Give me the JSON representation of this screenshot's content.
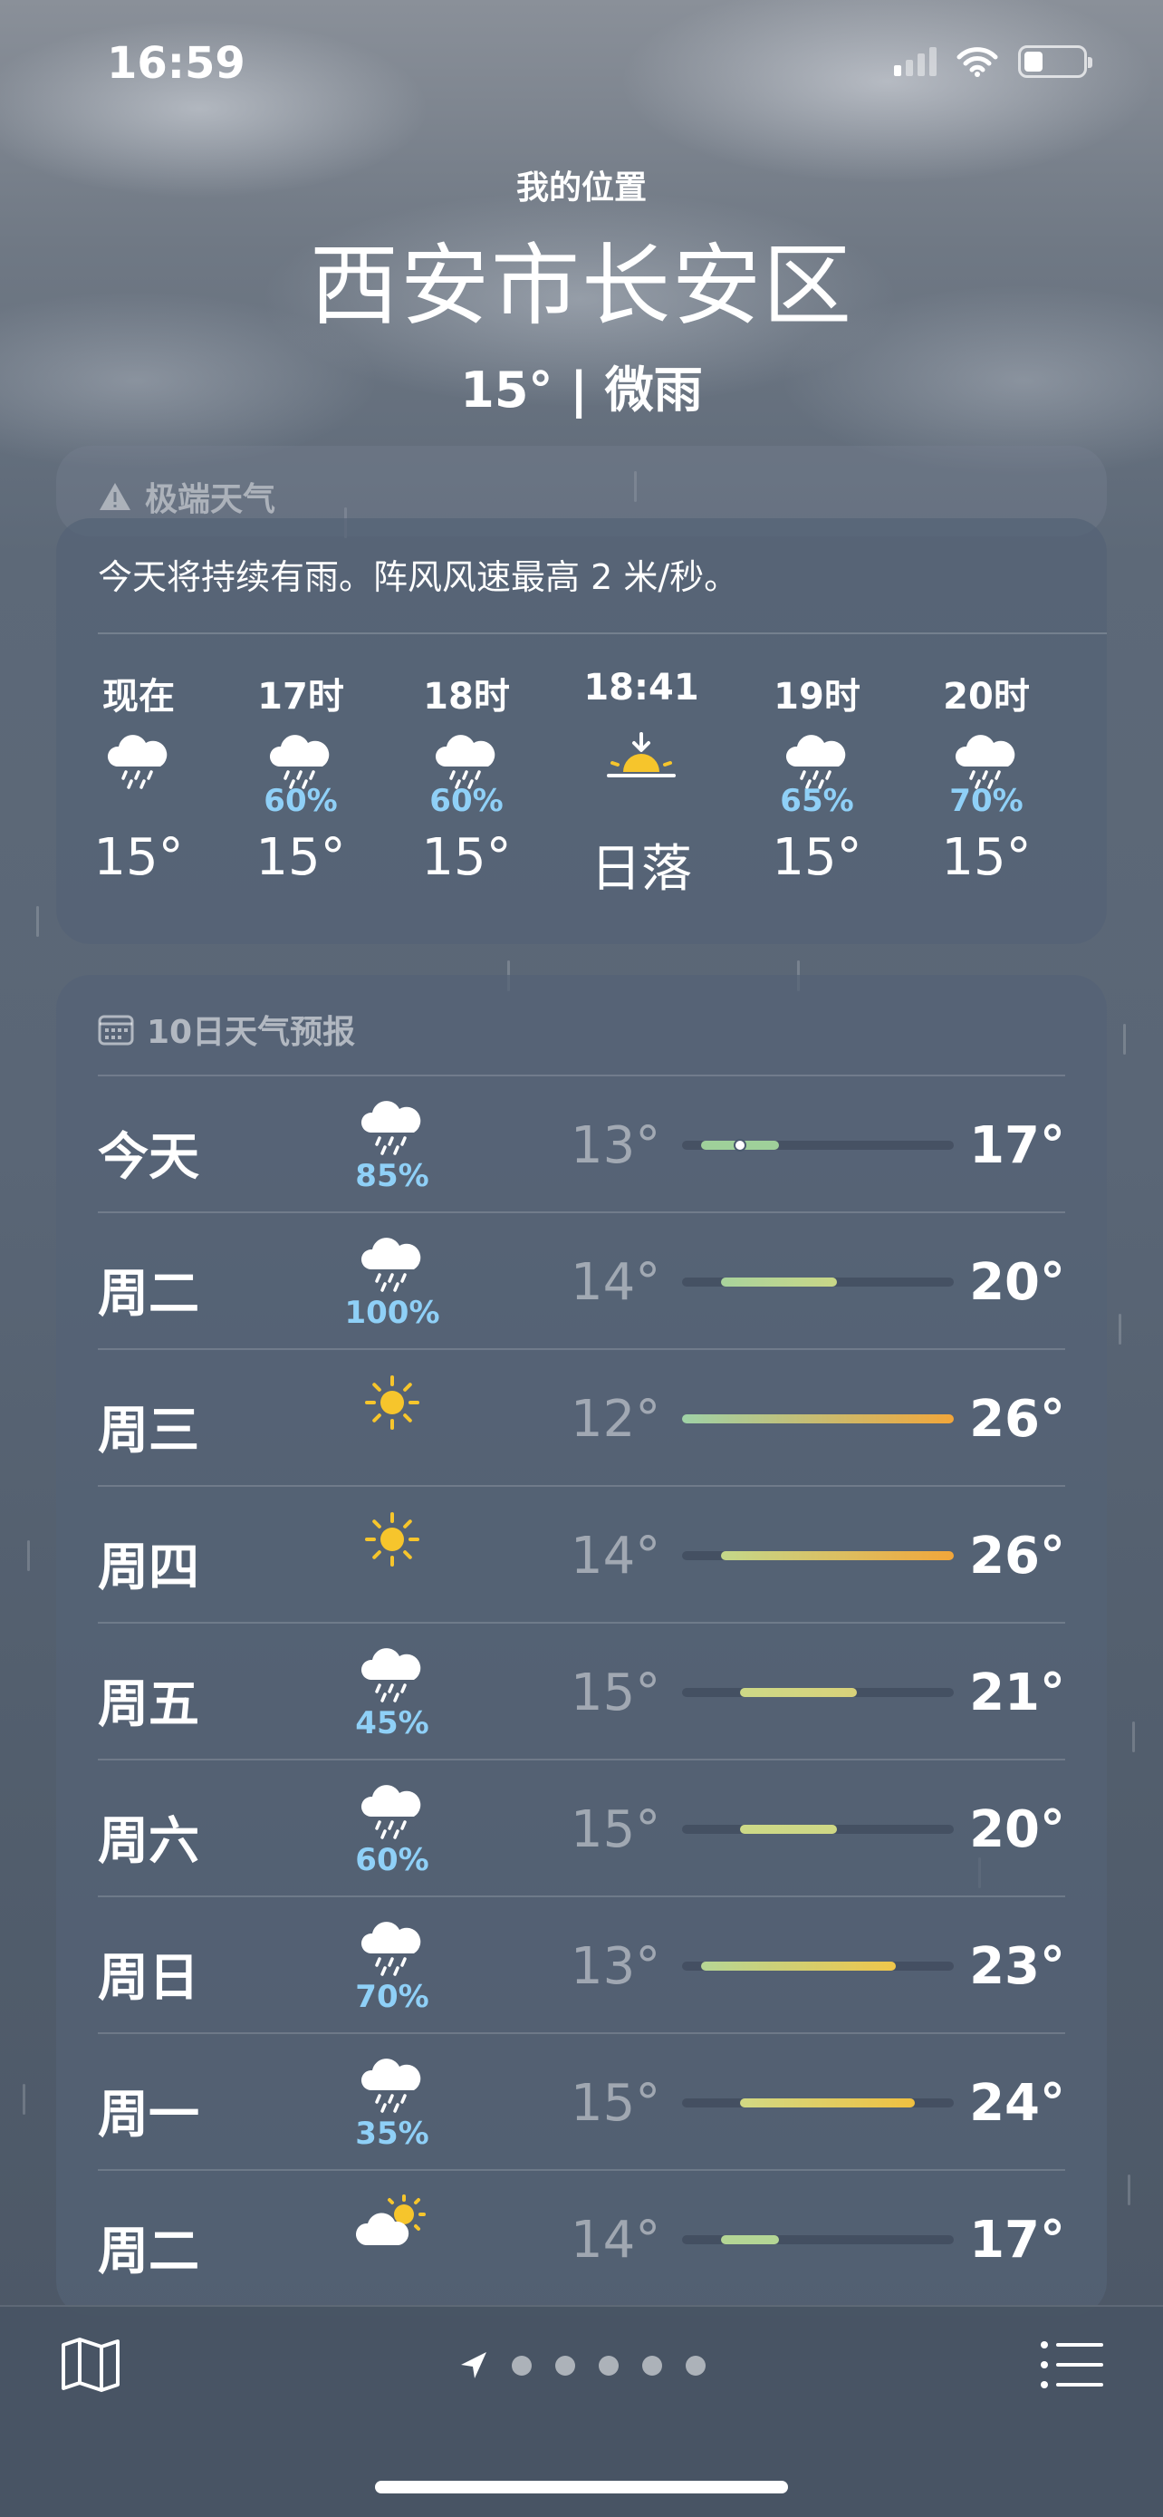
{
  "status_bar": {
    "time": "16:59"
  },
  "header": {
    "location_label": "我的位置",
    "city": "西安市长安区",
    "current": "15° | 微雨"
  },
  "alert": {
    "title": "极端天气"
  },
  "hourly": {
    "summary": "今天将持续有雨。阵风风速最高 2 米/秒。",
    "items": [
      {
        "label": "现在",
        "icon": "rain-cloud-icon",
        "precip": "",
        "temp": "15°"
      },
      {
        "label": "17时",
        "icon": "rain-cloud-icon",
        "precip": "60%",
        "temp": "15°"
      },
      {
        "label": "18时",
        "icon": "rain-cloud-icon",
        "precip": "60%",
        "temp": "15°"
      },
      {
        "label": "18:41",
        "icon": "sunset-icon",
        "precip": "",
        "temp": "日落"
      },
      {
        "label": "19时",
        "icon": "rain-cloud-icon",
        "precip": "65%",
        "temp": "15°"
      },
      {
        "label": "20时",
        "icon": "rain-cloud-icon",
        "precip": "70%",
        "temp": "15°"
      }
    ]
  },
  "daily": {
    "title": "10日天气预报",
    "range_min": 12,
    "range_max": 26,
    "days": [
      {
        "day": "今天",
        "icon": "rain-cloud-icon",
        "precip": "85%",
        "low": "13°",
        "high": "17°",
        "low_val": 13,
        "high_val": 17,
        "current_val": 15,
        "bar_colors": [
          "#9fd09a",
          "#9fd09a"
        ]
      },
      {
        "day": "周二",
        "icon": "rain-cloud-icon",
        "precip": "100%",
        "low": "14°",
        "high": "20°",
        "low_val": 14,
        "high_val": 20,
        "bar_colors": [
          "#a9d39c",
          "#c9d787"
        ]
      },
      {
        "day": "周三",
        "icon": "sun-icon",
        "precip": "",
        "low": "12°",
        "high": "26°",
        "low_val": 12,
        "high_val": 26,
        "bar_colors": [
          "#9fd2a7",
          "#f2a63a"
        ]
      },
      {
        "day": "周四",
        "icon": "sun-icon",
        "precip": "",
        "low": "14°",
        "high": "26°",
        "low_val": 14,
        "high_val": 26,
        "bar_colors": [
          "#c4d88a",
          "#f2a63a"
        ]
      },
      {
        "day": "周五",
        "icon": "rain-cloud-icon",
        "precip": "45%",
        "low": "15°",
        "high": "21°",
        "low_val": 15,
        "high_val": 21,
        "bar_colors": [
          "#cdd987",
          "#d9d27a"
        ]
      },
      {
        "day": "周六",
        "icon": "rain-cloud-icon",
        "precip": "60%",
        "low": "15°",
        "high": "20°",
        "low_val": 15,
        "high_val": 20,
        "bar_colors": [
          "#cdd987",
          "#cfd885"
        ]
      },
      {
        "day": "周日",
        "icon": "rain-cloud-icon",
        "precip": "70%",
        "low": "13°",
        "high": "23°",
        "low_val": 13,
        "high_val": 23,
        "bar_colors": [
          "#b6d695",
          "#f0c64a"
        ]
      },
      {
        "day": "周一",
        "icon": "rain-cloud-icon",
        "precip": "35%",
        "low": "15°",
        "high": "24°",
        "low_val": 15,
        "high_val": 24,
        "bar_colors": [
          "#d2d984",
          "#f0c040"
        ]
      },
      {
        "day": "周二",
        "icon": "partly-sunny-icon",
        "precip": "",
        "low": "14°",
        "high": "17°",
        "low_val": 14,
        "high_val": 17,
        "bar_colors": [
          "#b4d695",
          "#b4d695"
        ]
      }
    ]
  },
  "bottom_bar": {
    "page_count": 5
  }
}
